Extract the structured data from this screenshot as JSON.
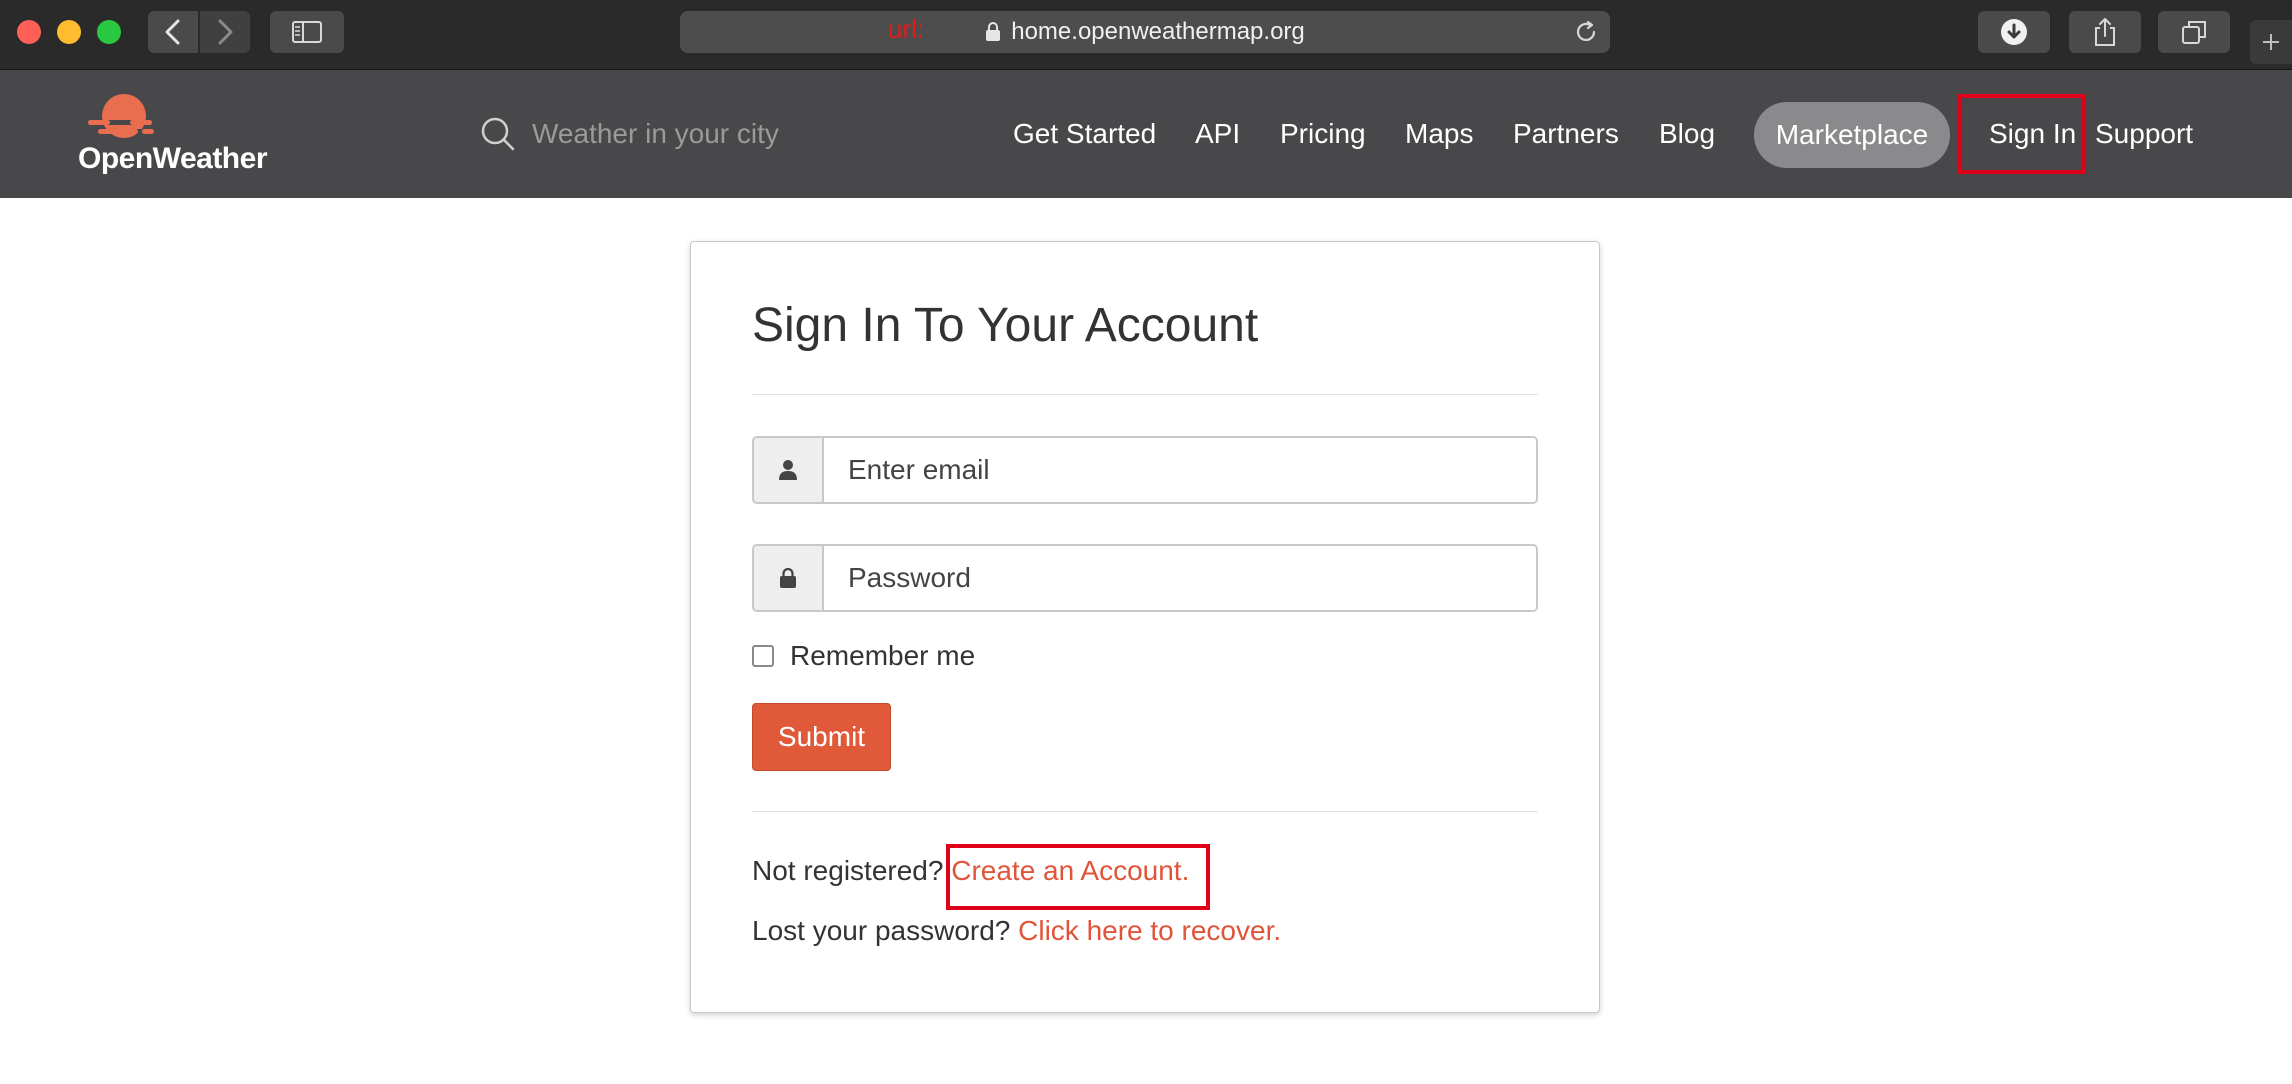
{
  "browser": {
    "url_annotation": "url:",
    "url": "home.openweathermap.org",
    "icons": [
      "back-icon",
      "forward-icon",
      "sidebar-icon",
      "lock-icon",
      "reload-icon",
      "download-icon",
      "share-icon",
      "tabs-icon",
      "plus-icon"
    ]
  },
  "header": {
    "logo_text": "OpenWeather",
    "search_placeholder": "Weather in your city",
    "nav": [
      {
        "label": "Get Started"
      },
      {
        "label": "API"
      },
      {
        "label": "Pricing"
      },
      {
        "label": "Maps"
      },
      {
        "label": "Partners"
      },
      {
        "label": "Blog"
      },
      {
        "label": "Marketplace"
      },
      {
        "label": "Sign In"
      },
      {
        "label": "Support"
      }
    ]
  },
  "login": {
    "title": "Sign In To Your Account",
    "email_placeholder": "Enter email",
    "password_placeholder": "Password",
    "remember_label": "Remember me",
    "submit_label": "Submit",
    "not_registered": "Not registered?",
    "create_account": "Create an Account.",
    "lost_password": "Lost your password?",
    "recover_link": "Click here to recover."
  },
  "colors": {
    "accent": "#e0543a",
    "header_bg": "#48484a",
    "highlight_box": "#e0001a"
  }
}
